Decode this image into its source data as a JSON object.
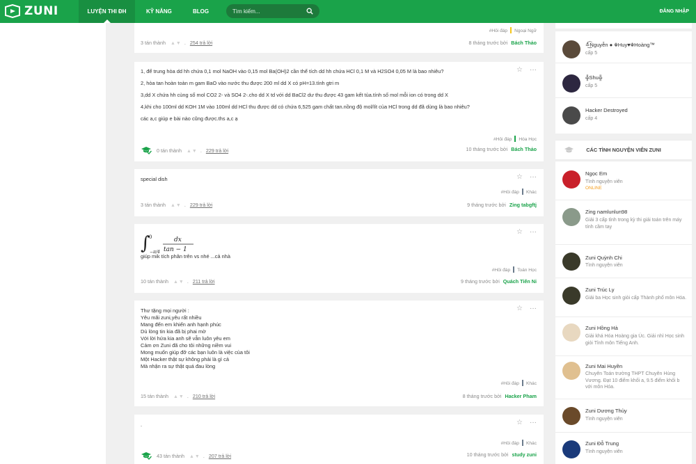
{
  "header": {
    "logo_text": "ZUNI",
    "nav": [
      "LUYỆN THI ĐH",
      "KỸ NĂNG",
      "BLOG"
    ],
    "search_placeholder": "Tìm kiếm...",
    "login": "ĐĂNG NHẬP"
  },
  "posts": [
    {
      "tag1": "#Hỏi đáp",
      "tag2": "Ngoại Ngữ",
      "thanks": "3 tán thành",
      "replies": "254 trả lời",
      "time": "8 tháng trước bởi",
      "author": "Bách Thảo"
    },
    {
      "lines": [
        "1, để trung hòa dd hh chứa 0,1 mol NaOH vào 0,15 mol Ba(OH)2 cần thể tích dd hh chứa HCl 0,1 M và H2SO4 0,05 M là bao nhiêu?",
        "2, hòa tan hoàn toàn m gam BaO vào nước thu được 200 ml dd X có pH=13.tính gtri m",
        "3,dd X chứa hh cùng số mol CO2 2- và SO4 2-.cho dd X td với dd BaCl2 dư thu được 43 gam kết tủa.tính số mol mỗi ion có trong dd X",
        "4,khi cho 100ml dd KOH 1M vào 100ml dd HCl thu được dd có chứa 6,525 gam chất tan.nồng độ mol/lít của HCl trong dd đã dùng là bao nhiêu?",
        "các a,c giúp e bài nào cũng được.ths a,c ạ"
      ],
      "tag1": "#Hỏi đáp",
      "tag2": "Hóa Học",
      "thanks": "0 tán thành",
      "replies": "229 trả lời",
      "time": "10 tháng trước bởi",
      "author": "Bách Thảo"
    },
    {
      "text": "special dish",
      "tag1": "#Hỏi đáp",
      "tag2": "Khác",
      "thanks": "3 tán thành",
      "replies": "229 trả lời",
      "time": "9 tháng trước bởi",
      "author": "Zing tabgftj"
    },
    {
      "math_numerator": "dx",
      "math_denominator": "tan − 1",
      "math_upper": "0",
      "math_lower": "−π/4",
      "text": "giúp mik tích phân trên vs nhé ...cả nhà",
      "tag1": "#Hỏi đáp",
      "tag2": "Toán Học",
      "thanks": "10 tán thành",
      "replies": "211 trả lời",
      "time": "9 tháng trước bởi",
      "author": "Quách Tiến Ni"
    },
    {
      "lines": [
        "Thư tặng mọi người :",
        "Yêu mãi zuni,yêu rất nhiều",
        "Mang đến em khiến anh hạnh phúc",
        "Dù lòng tin kia đã bị phai mờ",
        "Với lời hứa kia anh sẽ vẫn luôn yêu em",
        "Cảm ơn Zuni đã cho tôi những niềm vui",
        "Mong muốn giúp đỡ các bạn luôn là việc của tôi",
        "Một Hacker thật sự không phải là gì cả",
        "Mà nhận ra sự thật quá đau lòng"
      ],
      "tag1": "#Hỏi đáp",
      "tag2": "Khác",
      "thanks": "15 tán thành",
      "replies": "210 trả lời",
      "time": "8 tháng trước bởi",
      "author": "Hacker Pham"
    },
    {
      "text": ".",
      "tag1": "#Hỏi đáp",
      "tag2": "Khác",
      "thanks": "43 tán thành",
      "replies": "207 trả lời",
      "time": "10 tháng trước bởi",
      "author": "study zuni"
    }
  ],
  "top_users": [
    {
      "name": "≛͜͡Nguyễn ● ☬Huy♥☬Hoàng™",
      "rank": "cấp 5",
      "avatar_color": "#5a4a3a"
    },
    {
      "name": "╬Shu╬",
      "rank": "cấp 5",
      "avatar_color": "#2d2740"
    },
    {
      "name": "Hacker Destroyed",
      "rank": "cấp 4",
      "avatar_color": "#4a4a4a"
    }
  ],
  "volunteers_title": "CÁC TÌNH NGUYỆN VIÊN ZUNI",
  "volunteers": [
    {
      "name": "Ngọc Em",
      "desc": "Tình nguyện viên",
      "online": "ONLINE",
      "avatar_color": "#c9202a"
    },
    {
      "name": "Zing namlunlun98",
      "desc": "Giải 3 cấp tỉnh trong kỳ thi giải toán trên máy tính cầm tay",
      "avatar_color": "#8a9a8a"
    },
    {
      "name": "Zuni Quỳnh Chi",
      "desc": "Tình nguyện viên",
      "avatar_color": "#3a3a2a"
    },
    {
      "name": "Zuni Trúc Ly",
      "desc": "Giải ba Học sinh giỏi cấp Thành phố môn Hóa.",
      "avatar_color": "#3a3a2a"
    },
    {
      "name": "Zuni Hồng Hà",
      "desc": "Giải khá Hóa Hoàng gia Úc. Giải nhì Học sinh giỏi Tỉnh môn Tiếng Anh.",
      "avatar_color": "#e8d8c0"
    },
    {
      "name": "Zuni Mai Huyền",
      "desc": "Chuyên Toán trường THPT Chuyên Hùng Vương. Đạt 10 điểm khối a, 9.5 điểm khối b với môn Hóa.",
      "avatar_color": "#e0c090"
    },
    {
      "name": "Zuni Dương Thủy",
      "desc": "Tình nguyện viên",
      "avatar_color": "#6a4a2a"
    },
    {
      "name": "Zuni Đỗ Trung",
      "desc": "Tình nguyện viên",
      "avatar_color": "#1a3a7a"
    }
  ],
  "colors": {
    "brand": "#1aa34a",
    "brand_dark": "#188f41",
    "search_bg": "#1d7a3b",
    "online": "#f59d1b",
    "tag_yellow": "#f5c518",
    "tag_green": "#1aa34a",
    "tag_grey": "#6b7b8c"
  },
  "icons": [
    "logo-icon",
    "search-icon",
    "star-icon",
    "more-icon",
    "graduation-cap-icon",
    "vote-arrow-icon"
  ]
}
